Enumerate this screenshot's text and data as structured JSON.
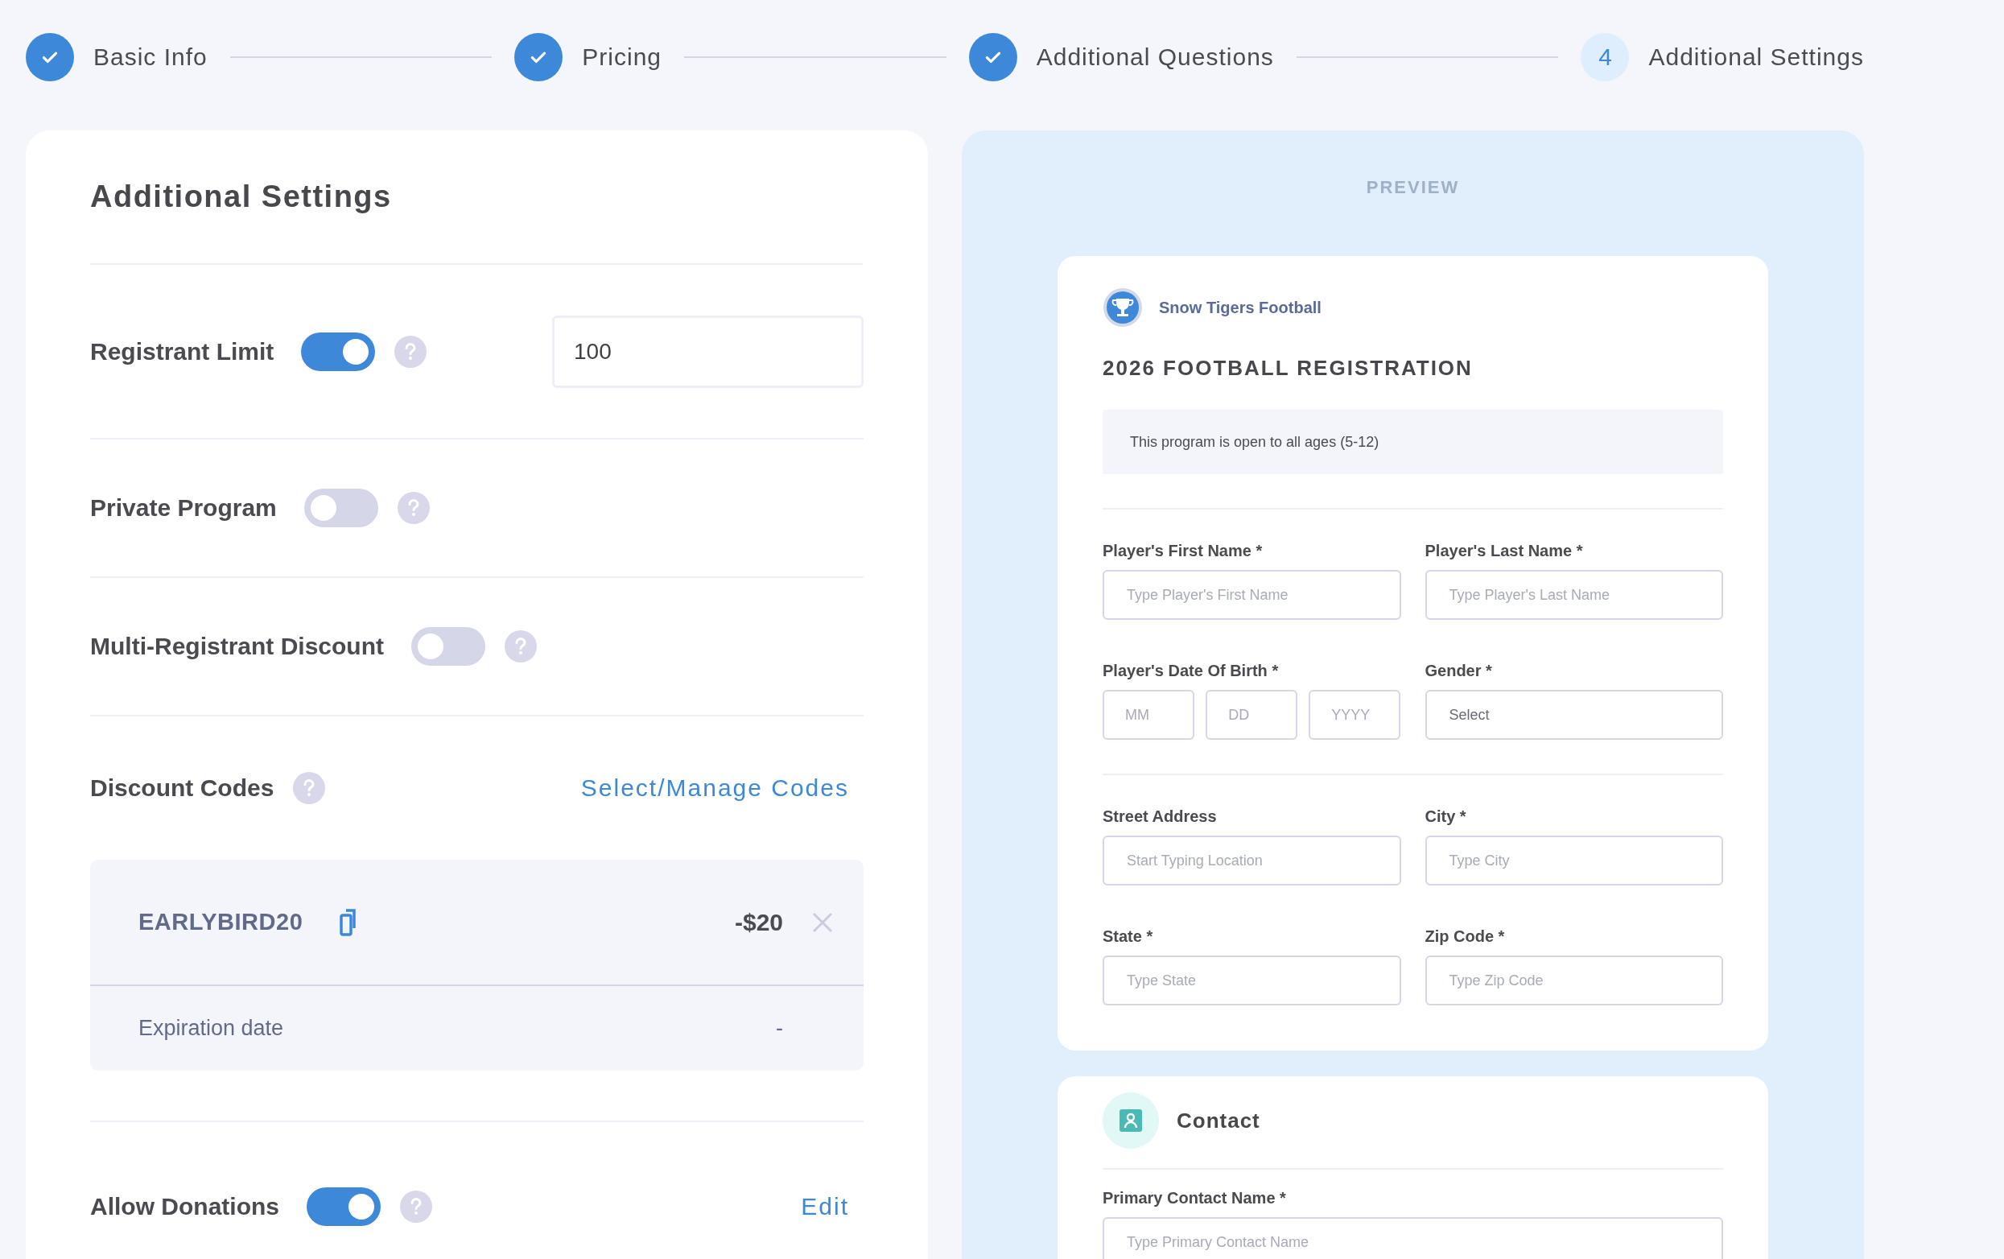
{
  "steps": [
    {
      "label": "Basic Info",
      "done": true
    },
    {
      "label": "Pricing",
      "done": true
    },
    {
      "label": "Additional Questions",
      "done": true
    },
    {
      "number": "4",
      "label": "Additional Settings",
      "done": false
    }
  ],
  "settings": {
    "title": "Additional Settings",
    "rows": [
      {
        "kind": "toggle",
        "label": "Registrant Limit",
        "on": true,
        "value": "100"
      },
      {
        "kind": "toggle",
        "label": "Private Program",
        "on": false
      },
      {
        "kind": "toggle",
        "label": "Multi-Registrant Discount",
        "on": false
      },
      {
        "kind": "codes",
        "label": "Discount Codes",
        "link": "Select/Manage Codes",
        "codes": [
          {
            "code": "EARLYBIRD20",
            "amount": "-$20",
            "expiration_label": "Expiration date",
            "expiration": "-"
          }
        ]
      },
      {
        "kind": "toggle",
        "label": "Allow Donations",
        "on": true,
        "link": "Edit"
      }
    ]
  },
  "preview": {
    "heading": "PREVIEW",
    "org": "Snow Tigers Football",
    "title": "2026 FOOTBALL REGISTRATION",
    "notice": "This program is open to all ages (5-12)",
    "groups": [
      [
        [
          {
            "kind": "text",
            "label": "Player's First Name *",
            "placeholder": "Type Player's First Name"
          },
          {
            "kind": "text",
            "label": "Player's Last Name *",
            "placeholder": "Type Player's Last Name"
          }
        ],
        [
          {
            "kind": "date",
            "label": "Player's Date Of Birth *",
            "placeholders": [
              "MM",
              "DD",
              "YYYY"
            ]
          },
          {
            "kind": "select",
            "label": "Gender *",
            "placeholder": "Select"
          }
        ]
      ],
      [
        [
          {
            "kind": "text",
            "label": "Street Address",
            "placeholder": "Start Typing Location"
          },
          {
            "kind": "text",
            "label": "City *",
            "placeholder": "Type City"
          }
        ],
        [
          {
            "kind": "text",
            "label": "State *",
            "placeholder": "Type State"
          },
          {
            "kind": "text",
            "label": "Zip Code *",
            "placeholder": "Type Zip Code"
          }
        ]
      ]
    ],
    "contact": {
      "title": "Contact",
      "fields": [
        {
          "kind": "text",
          "label": "Primary Contact Name *",
          "placeholder": "Type Primary Contact Name"
        }
      ]
    }
  }
}
